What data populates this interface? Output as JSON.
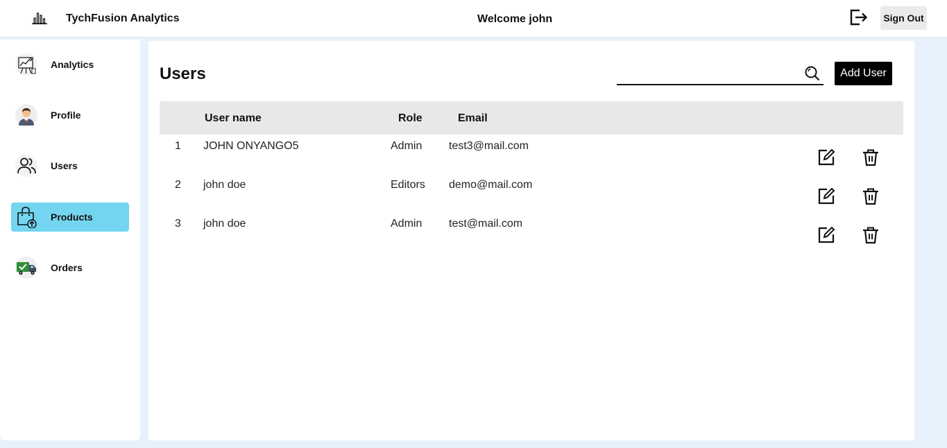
{
  "header": {
    "brand_icon": "bar-chart-icon",
    "brand_name": "TychFusion Analytics",
    "welcome": "Welcome john",
    "logout_icon": "logout-icon",
    "signout_label": "Sign Out"
  },
  "sidebar": {
    "items": [
      {
        "label": "Analytics",
        "icon": "analytics-icon",
        "active": false
      },
      {
        "label": "Profile",
        "icon": "profile-avatar-icon",
        "active": false
      },
      {
        "label": "Users",
        "icon": "users-icon",
        "active": false
      },
      {
        "label": "Products",
        "icon": "shopping-bag-icon",
        "active": true
      },
      {
        "label": "Orders",
        "icon": "delivery-truck-icon",
        "active": false
      }
    ],
    "active_color": "#74d5f0"
  },
  "main": {
    "title": "Users",
    "search": {
      "value": "",
      "placeholder": "",
      "icon": "search-icon"
    },
    "add_button_label": "Add User",
    "table": {
      "columns": [
        "",
        "User name",
        "Role",
        "Email"
      ],
      "rows": [
        {
          "index": "1",
          "name": "JOHN ONYANGO5",
          "role": "Admin",
          "email": "test3@mail.com"
        },
        {
          "index": "2",
          "name": "john doe",
          "role": "Editors",
          "email": "demo@mail.com"
        },
        {
          "index": "3",
          "name": "john doe",
          "role": "Admin",
          "email": "test@mail.com"
        }
      ],
      "row_actions": [
        "edit-icon",
        "trash-icon"
      ]
    }
  }
}
